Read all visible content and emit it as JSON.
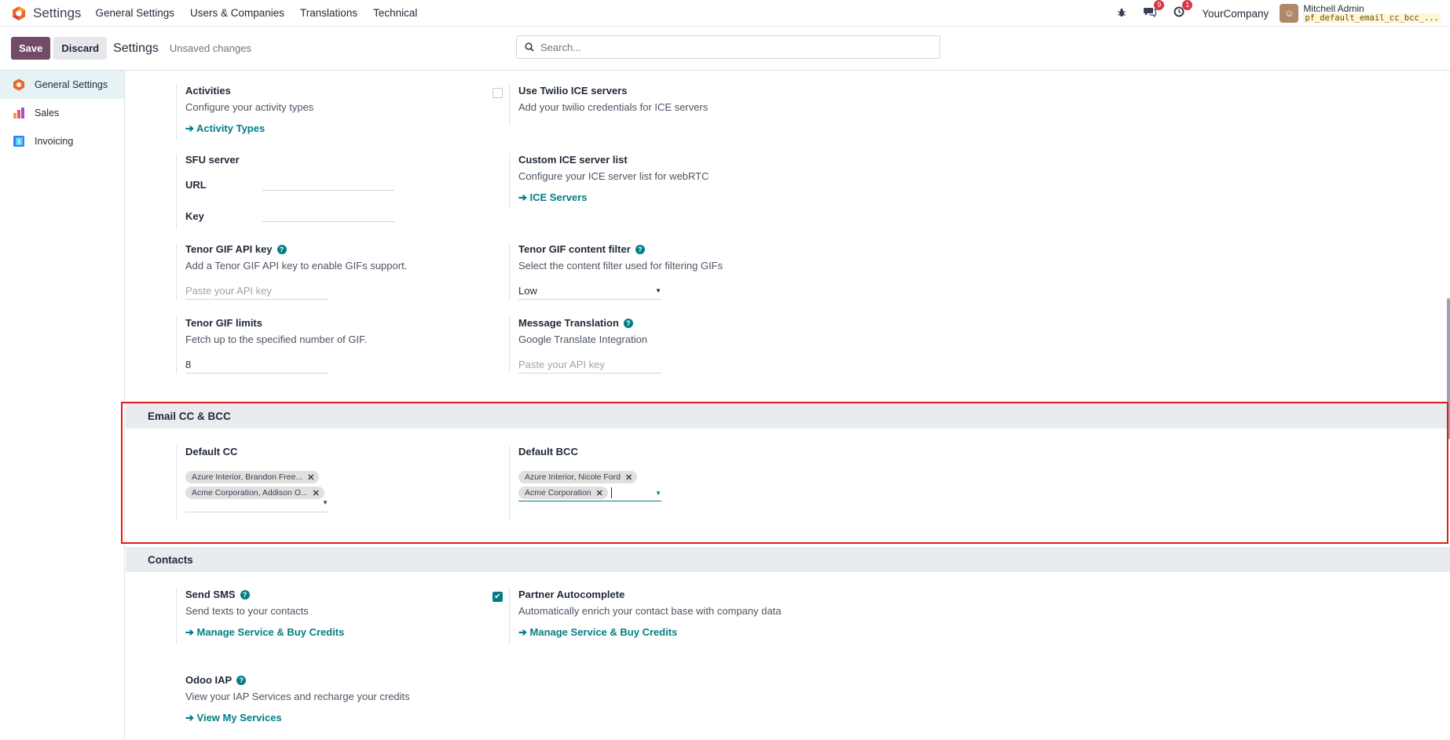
{
  "navbar": {
    "app_name": "Settings",
    "menu": [
      "General Settings",
      "Users & Companies",
      "Translations",
      "Technical"
    ],
    "messages_badge": "9",
    "activities_badge": "1",
    "company": "YourCompany",
    "user_name": "Mitchell Admin",
    "db_name": "pf_default_email_cc_bcc_..."
  },
  "control_panel": {
    "save_label": "Save",
    "discard_label": "Discard",
    "title": "Settings",
    "status": "Unsaved changes",
    "search_placeholder": "Search..."
  },
  "sidebar": {
    "items": [
      {
        "label": "General Settings",
        "active": true
      },
      {
        "label": "Sales"
      },
      {
        "label": "Invoicing"
      }
    ]
  },
  "settings": {
    "activities": {
      "title": "Activities",
      "desc": "Configure your activity types",
      "link": "Activity Types"
    },
    "twilio": {
      "title": "Use Twilio ICE servers",
      "desc": "Add your twilio credentials for ICE servers",
      "checked": false
    },
    "sfu": {
      "title": "SFU server",
      "url_label": "URL",
      "key_label": "Key"
    },
    "ice_list": {
      "title": "Custom ICE server list",
      "desc": "Configure your ICE server list for webRTC",
      "link": "ICE Servers"
    },
    "tenor_key": {
      "title": "Tenor GIF API key",
      "desc": "Add a Tenor GIF API key to enable GIFs support.",
      "placeholder": "Paste your API key"
    },
    "tenor_filter": {
      "title": "Tenor GIF content filter",
      "desc": "Select the content filter used for filtering GIFs",
      "value": "Low"
    },
    "tenor_limits": {
      "title": "Tenor GIF limits",
      "desc": "Fetch up to the specified number of GIF.",
      "value": "8"
    },
    "msg_translation": {
      "title": "Message Translation",
      "desc": "Google Translate Integration",
      "placeholder": "Paste your API key"
    }
  },
  "email_section": {
    "header": "Email CC & BCC",
    "default_cc": {
      "title": "Default CC",
      "tags": [
        "Azure Interior, Brandon Free...",
        "Acme Corporation, Addison O..."
      ]
    },
    "default_bcc": {
      "title": "Default BCC",
      "tags": [
        "Azure Interior, Nicole Ford",
        "Acme Corporation"
      ]
    }
  },
  "contacts_section": {
    "header": "Contacts",
    "send_sms": {
      "title": "Send SMS",
      "desc": "Send texts to your contacts",
      "link": "Manage Service & Buy Credits"
    },
    "partner_autocomplete": {
      "title": "Partner Autocomplete",
      "desc": "Automatically enrich your contact base with company data",
      "link": "Manage Service & Buy Credits",
      "checked": true
    },
    "odoo_iap": {
      "title": "Odoo IAP",
      "desc": "View your IAP Services and recharge your credits",
      "link": "View My Services"
    }
  },
  "colors": {
    "brand": "#714b67",
    "accent": "#017e84",
    "highlight": "#e01d1d"
  },
  "icons": [
    "odoo-logo-icon",
    "bug-icon",
    "chat-icon",
    "clock-icon",
    "search-icon",
    "arrow-right-icon",
    "help-icon",
    "remove-tag-icon",
    "caret-down-icon"
  ]
}
